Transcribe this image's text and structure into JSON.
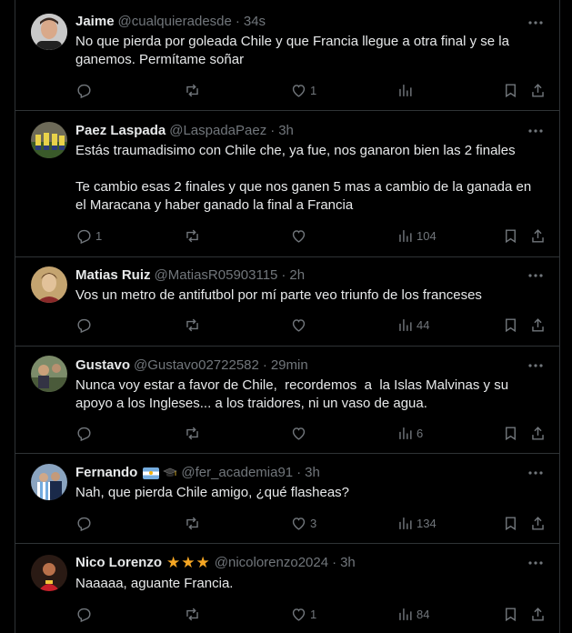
{
  "replies": [
    {
      "name": "Jaime",
      "handle": "@cualquieradesde",
      "time": "34s",
      "text": "No que pierda por goleada Chile y que Francia llegue a otra final y se la\nganemos. Permítame soñar",
      "replies": "",
      "reposts": "",
      "likes": "1",
      "views": ""
    },
    {
      "name": "Paez Laspada",
      "handle": "@LaspadaPaez",
      "time": "3h",
      "text": "Estás traumadisimo con Chile che, ya fue, nos ganaron bien las 2 finales\n\nTe cambio esas 2 finales y que nos ganen 5 mas a cambio de la ganada en\nel Maracana y haber ganado la final a Francia",
      "replies": "1",
      "reposts": "",
      "likes": "",
      "views": "104"
    },
    {
      "name": "Matias Ruiz",
      "handle": "@MatiasR05903115",
      "time": "2h",
      "text": "Vos un metro de antifutbol por mí parte veo triunfo de los franceses",
      "replies": "",
      "reposts": "",
      "likes": "",
      "views": "44"
    },
    {
      "name": "Gustavo",
      "handle": "@Gustavo02722582",
      "time": "29min",
      "text": "Nunca voy estar a favor de Chile,  recordemos  a  la Islas Malvinas y su\napoyo a los Ingleses... a los traidores, ni un vaso de agua.",
      "replies": "",
      "reposts": "",
      "likes": "",
      "views": "6"
    },
    {
      "name": "Fernando",
      "handle": "@fer_academia91",
      "time": "3h",
      "text": "Nah, que pierda Chile amigo, ¿qué flasheas?",
      "replies": "",
      "reposts": "",
      "likes": "3",
      "views": "134"
    },
    {
      "name": "Nico Lorenzo",
      "handle": "@nicolorenzo2024",
      "time": "3h",
      "text": "Naaaaa, aguante Francia.",
      "replies": "",
      "reposts": "",
      "likes": "1",
      "views": "84"
    }
  ],
  "separator": "·",
  "badges": {
    "fernando": [
      "argentina-flag-icon",
      "graduation-cap-icon"
    ],
    "nico_stars": "★★★"
  },
  "colors": {
    "background": "#000000",
    "text": "#e7e9ea",
    "secondary": "#71767b",
    "border": "#2f3336",
    "star": "#f5a623"
  }
}
